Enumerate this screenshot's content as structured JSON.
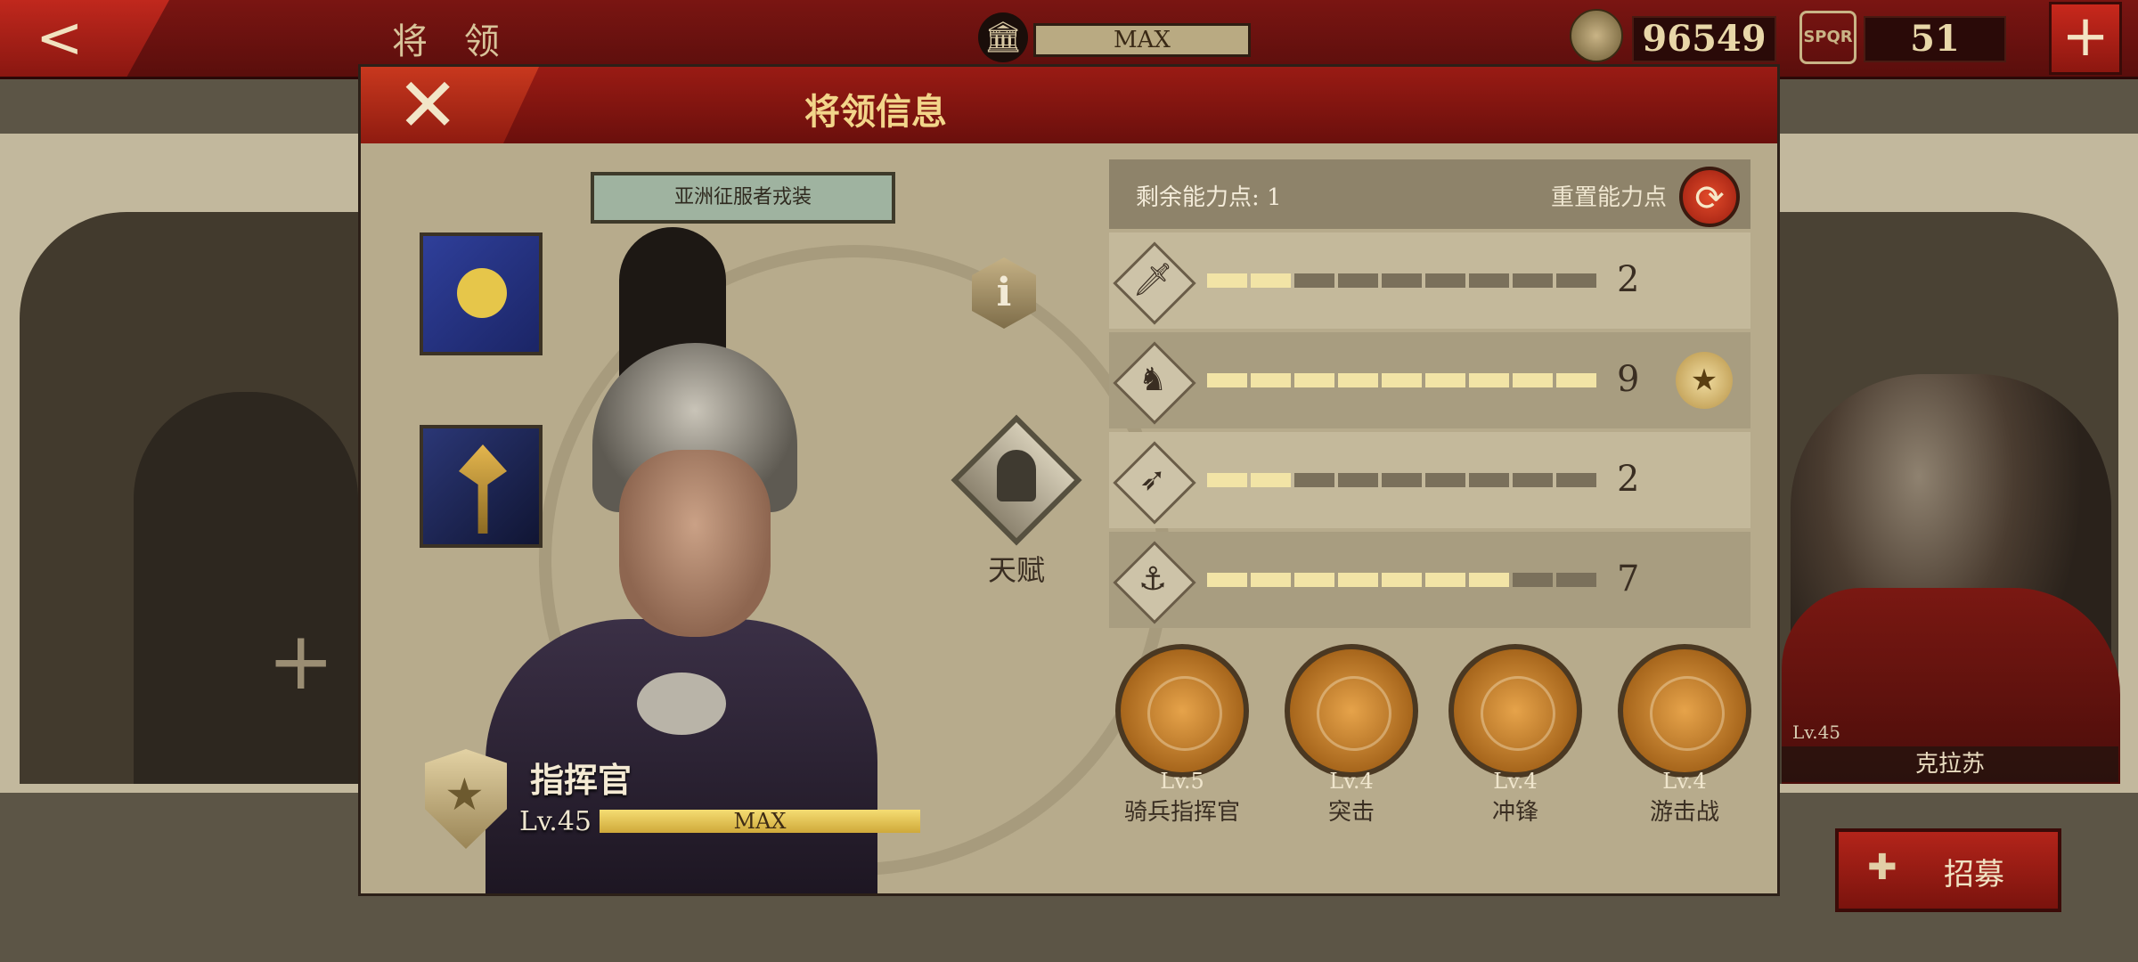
{
  "topbar": {
    "title": "将 领",
    "bank_icon": "bank-icon",
    "max_label": "MAX",
    "gold": "96549",
    "spqr_icon_text": "SPQR",
    "spqr_count": "51"
  },
  "side_right": {
    "level": "Lv.45",
    "name": "克拉苏"
  },
  "recruit": {
    "label": "招募"
  },
  "dialog": {
    "title": "将领信息",
    "costume": "亚洲征服者戎装",
    "info_glyph": "i",
    "talent_label": "天赋",
    "rank_name": "指挥官",
    "level": "Lv.45",
    "xp_label": "MAX",
    "xp_fraction": 1.0,
    "remaining_points": "剩余能力点: 1",
    "reset_label": "重置能力点",
    "stats": [
      {
        "icon": "sword-icon",
        "glyph": "🗡",
        "value": "2",
        "filled": 2,
        "total": 9,
        "medal": false
      },
      {
        "icon": "horse-icon",
        "glyph": "♞",
        "value": "9",
        "filled": 9,
        "total": 9,
        "medal": true
      },
      {
        "icon": "bow-icon",
        "glyph": "➶",
        "value": "2",
        "filled": 2,
        "total": 9,
        "medal": false
      },
      {
        "icon": "anchor-icon",
        "glyph": "⚓",
        "value": "7",
        "filled": 7,
        "total": 9,
        "medal": false
      }
    ],
    "skills": [
      {
        "level": "Lv.5",
        "name": "骑兵指挥官"
      },
      {
        "level": "Lv.4",
        "name": "突击"
      },
      {
        "level": "Lv.4",
        "name": "冲锋"
      },
      {
        "level": "Lv.4",
        "name": "游击战"
      }
    ]
  }
}
